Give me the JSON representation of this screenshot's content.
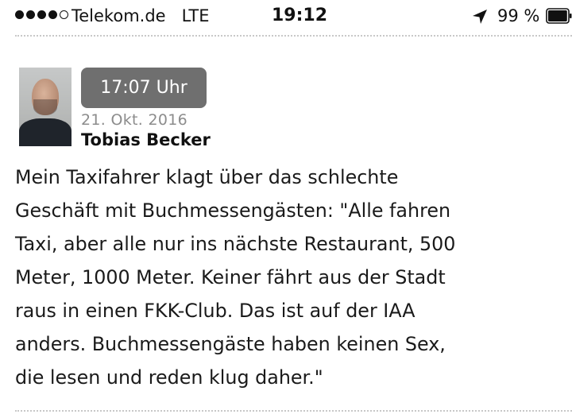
{
  "status_bar": {
    "signal_dots_filled": 4,
    "signal_dots_total": 5,
    "carrier": "Telekom.de",
    "network": "LTE",
    "time": "19:12",
    "location_icon": "location-arrow-icon",
    "battery_percent": "99 %",
    "battery_level": 0.99
  },
  "post": {
    "avatar_icon": "profile-photo",
    "time_badge": "17:07 Uhr",
    "date": "21. Okt. 2016",
    "author": "Tobias Becker",
    "text_lines": [
      "Mein Taxifahrer klagt über das schlechte",
      "Geschäft mit Buchmessengästen: \"Alle fahren",
      "Taxi, aber alle nur ins nächste Restaurant, 500",
      "Meter, 1000 Meter. Keiner fährt aus der Stadt",
      "raus in einen FKK-Club. Das ist auf der IAA",
      "anders. Buchmessengäste haben keinen Sex,",
      "die lesen und reden klug daher.\""
    ]
  }
}
